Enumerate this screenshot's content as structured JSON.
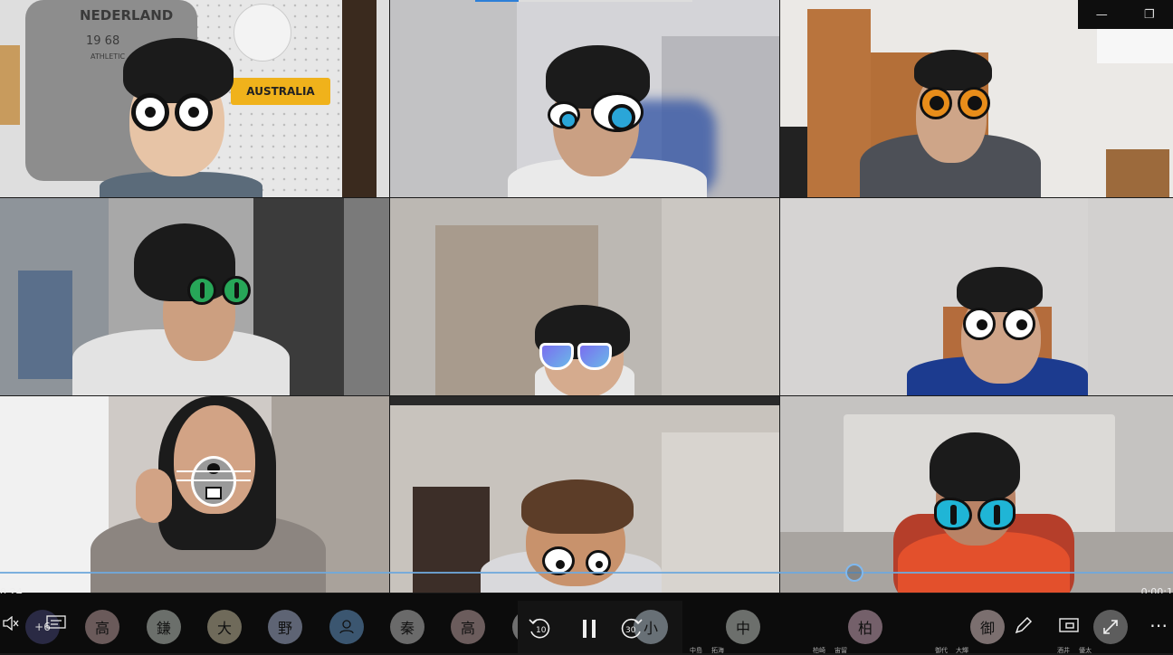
{
  "window": {
    "minimize_icon": "minimize-icon",
    "restore_icon": "restore-icon",
    "minimize_glyph": "—",
    "restore_glyph": "❐"
  },
  "tiles": [
    {
      "name": "participant-1",
      "bg": "#dcdcdc",
      "filter": "round-glasses"
    },
    {
      "name": "participant-2",
      "bg": "#cfcfd3",
      "filter": "cartoon-blue-eyes"
    },
    {
      "name": "participant-3",
      "bg": "#e8e6e4",
      "filter": "owl-eyes"
    },
    {
      "name": "participant-4",
      "bg": "#a7a7a7",
      "filter": "green-cat-eyes"
    },
    {
      "name": "participant-5",
      "bg": "#bdbab6",
      "filter": "sunglasses"
    },
    {
      "name": "participant-6",
      "bg": "#d5d3d2",
      "filter": "googly-eyes"
    },
    {
      "name": "participant-7",
      "bg": "#cfcac6",
      "filter": "mouse-mask"
    },
    {
      "name": "participant-8",
      "bg": "#c5c0ba",
      "filter": "sad-eyes"
    },
    {
      "name": "participant-9",
      "bg": "#c7c5c3",
      "filter": "blue-cat-eyes"
    }
  ],
  "tile_labels": {
    "sign_text_1": "NEDERLAND",
    "sign_text_2": "19 68",
    "sign_text_3": "ATHLETIC",
    "australia_plate": "AUSTRALIA"
  },
  "timeline": {
    "elapsed": "0:24",
    "remaining": "0:00:1",
    "progress_fraction": 0.727
  },
  "bottom": {
    "mute_icon": "mute-icon",
    "captions_icon": "captions-icon",
    "extra_count": "+6",
    "participants": [
      {
        "initial": "高",
        "color": "#6a5a5a"
      },
      {
        "initial": "鎌",
        "color": "#6b6f6b"
      },
      {
        "initial": "大",
        "color": "#6f6a5a"
      },
      {
        "initial": "野",
        "color": "#5e6474"
      },
      {
        "initial": "",
        "color": "#3b5670",
        "is_icon": true
      },
      {
        "initial": "秦",
        "color": "#6a6a6a"
      },
      {
        "initial": "高",
        "color": "#6b5c5c"
      },
      {
        "initial": "吉",
        "color": "#6f6f6f"
      },
      {
        "initial": "小",
        "color": "#687076"
      },
      {
        "initial": "中",
        "color": "#6c6f6c"
      },
      {
        "initial": "柏",
        "color": "#74606a"
      },
      {
        "initial": "御",
        "color": "#7b6f6f"
      }
    ],
    "tiny_labels": [
      "中島",
      "拓海",
      "柏崎",
      "宙留",
      "御代",
      "大輝",
      "酒井",
      "優太"
    ],
    "rewind_label": "10",
    "forward_label": "30",
    "pause_icon": "pause-icon",
    "rewind_icon": "rewind-10-icon",
    "forward_icon": "forward-30-icon",
    "pen_icon": "pen-icon",
    "miniview_icon": "mini-view-icon",
    "fullscreen_icon": "fullscreen-icon",
    "more_icon": "more-icon",
    "more_glyph": "⋯"
  }
}
